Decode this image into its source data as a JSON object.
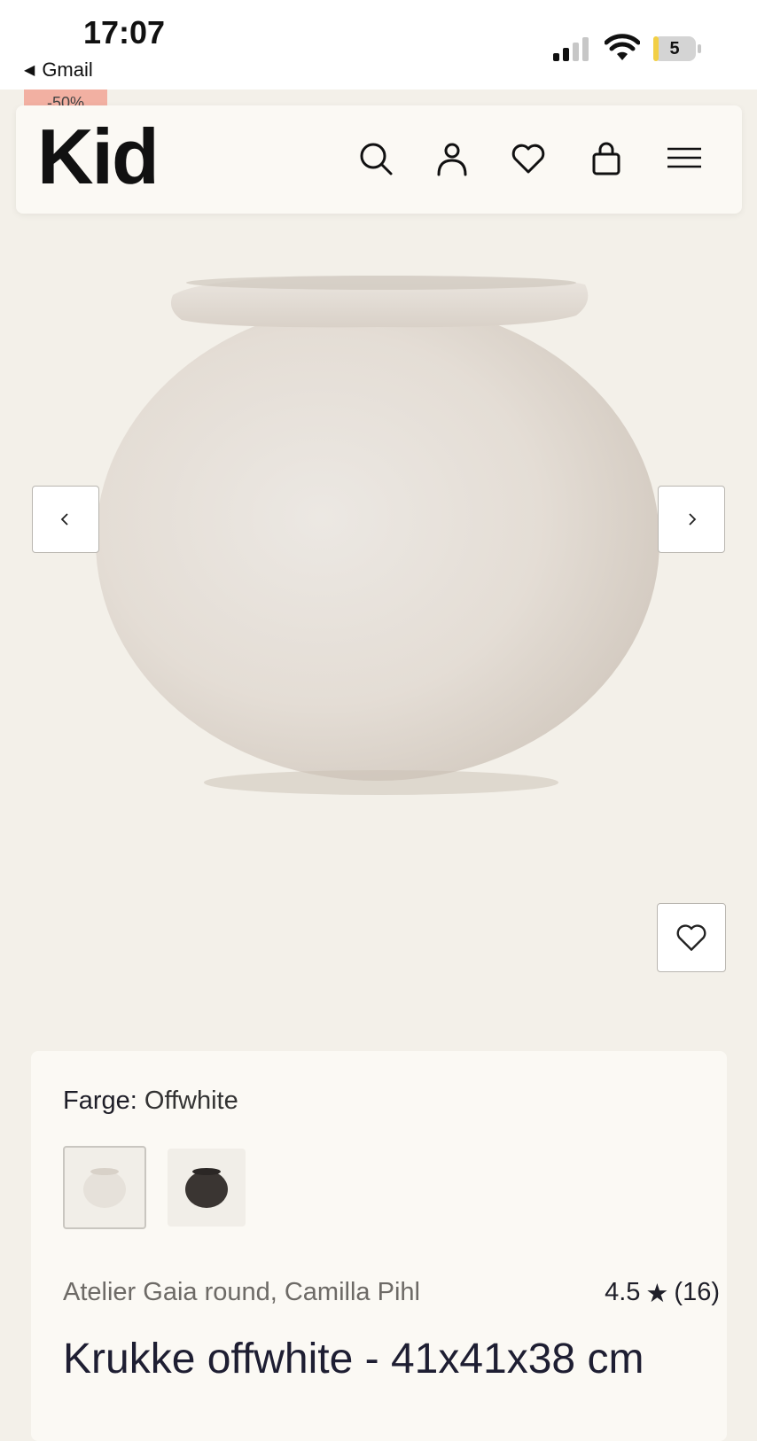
{
  "status_bar": {
    "time": "17:07",
    "back_app": "Gmail",
    "battery": "5"
  },
  "sale_badge": "-50%",
  "header": {
    "logo": "Kid",
    "icons": [
      "search-icon",
      "account-icon",
      "wishlist-icon",
      "cart-icon",
      "menu-icon"
    ]
  },
  "product": {
    "color_label": "Farge:",
    "color_value": "Offwhite",
    "variants": [
      {
        "name": "offwhite",
        "color": "#e6e1da",
        "selected": true
      },
      {
        "name": "dark",
        "color": "#3a3532",
        "selected": false
      }
    ],
    "brand_line": "Atelier Gaia round, Camilla Pihl",
    "rating_value": "4.5",
    "rating_star": "★",
    "rating_count": "(16)",
    "title": "Krukke offwhite - 41x41x38 cm"
  },
  "colors": {
    "page_bg": "#f3f0e9",
    "card_bg": "#fbf9f4",
    "sale": "#f2b0a2"
  }
}
